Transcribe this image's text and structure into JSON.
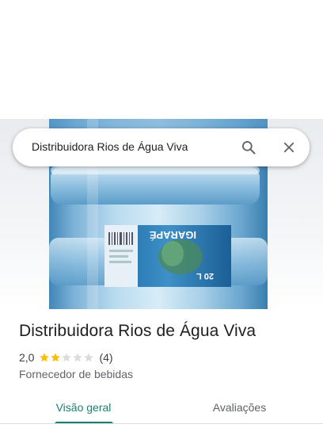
{
  "search": {
    "query": "Distribuidora Rios de Água Viva"
  },
  "icons": {
    "search": "search-icon",
    "close": "close-icon"
  },
  "photo": {
    "label_brand": "IGARAPÉ",
    "label_volume": "20 L"
  },
  "place": {
    "name": "Distribuidora Rios de Água Viva",
    "rating": "2,0",
    "rating_value": 2,
    "rating_max": 5,
    "review_count": "(4)",
    "category": "Fornecedor de bebidas"
  },
  "tabs": [
    {
      "label": "Visão geral",
      "active": true
    },
    {
      "label": "Avaliações",
      "active": false
    }
  ],
  "colors": {
    "accent": "#1a7f73",
    "star_filled": "#fbbc04",
    "star_empty": "#dadce0"
  }
}
